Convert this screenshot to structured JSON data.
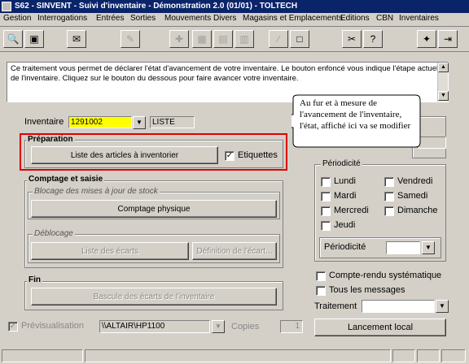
{
  "window": {
    "title": "S62 - SINVENT - Suivi d'inventaire - Démonstration 2.0 (01/01) - TOLTECH"
  },
  "menu": [
    "Gestion",
    "Interrogations",
    "Entrées",
    "Sorties",
    "Mouvements Divers",
    "Magasins et Emplacements",
    "Editions",
    "CBN",
    "Inventaires"
  ],
  "info_text": "Ce traitement vous permet de déclarer l'état d'avancement de votre inventaire. Le bouton enfoncé vous indique l'étape actuelle de l'inventaire. Cliquez sur le bouton du dessous pour faire avancer votre inventaire.",
  "inventaire": {
    "label": "Inventaire",
    "code": "1291002",
    "etat": "LISTE"
  },
  "callout": "Au fur et à mesure de l'avancement de l'inventaire, l'état, affiché ici va se modifier",
  "preparation": {
    "title": "Préparation",
    "button": "Liste des articles à inventorier",
    "etiquettes_label": "Etiquettes",
    "etiquettes_checked": true
  },
  "comptage": {
    "title": "Comptage et saisie",
    "blocage_title": "Blocage des mises à jour de stock",
    "blocage_button": "Comptage physique",
    "deblocage_title": "Déblocage",
    "ecarts_button": "Liste des écarts",
    "definition_button": "Définition de l'écart..."
  },
  "fin": {
    "title": "Fin",
    "button": "Bascule des écarts de l'inventaire"
  },
  "periodicite": {
    "title": "Périodicité",
    "days_left": [
      "Lundi",
      "Mardi",
      "Mercredi",
      "Jeudi"
    ],
    "days_right": [
      "Vendredi",
      "Samedi",
      "Dimanche"
    ],
    "field_label": "Périodicité",
    "field_value": ""
  },
  "options": {
    "compte_rendu": "Compte-rendu systématique",
    "tous_messages": "Tous les messages",
    "traitement_label": "Traitement",
    "traitement_value": ""
  },
  "bottom": {
    "previsualisation": "Prévisualisation",
    "printer": "\\\\ALTAIR\\HP1100",
    "copies_label": "Copies",
    "copies_value": "1",
    "lancement": "Lancement local"
  },
  "colors": {
    "highlight_border": "#e00000",
    "input_highlight": "#ffff00",
    "title_bg": "#0a246a"
  }
}
